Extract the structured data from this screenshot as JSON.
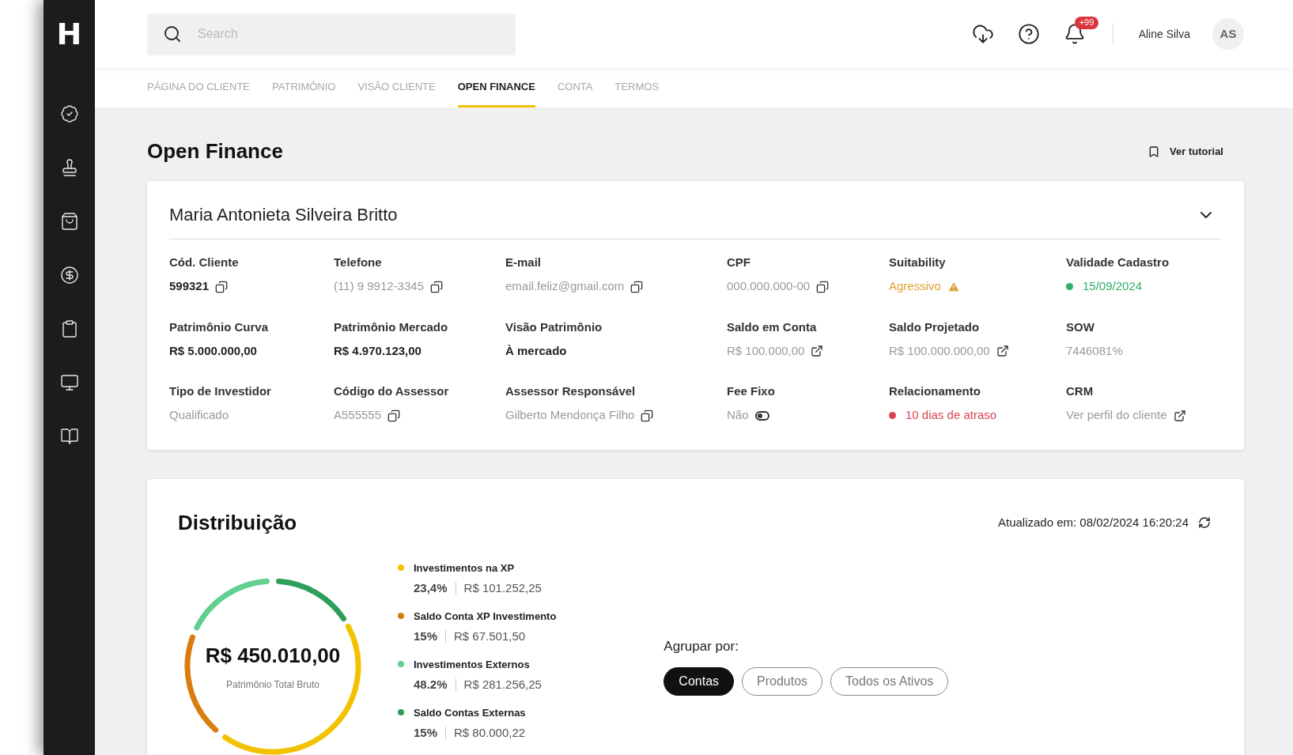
{
  "logo": "H",
  "search": {
    "placeholder": "Search"
  },
  "header": {
    "notifications_badge": "+99",
    "user_name": "Aline Silva",
    "avatar": "AS"
  },
  "tabs": [
    {
      "label": "PÁGINA DO CLIENTE",
      "selected": false
    },
    {
      "label": "PATRIMÔNIO",
      "selected": false
    },
    {
      "label": "VISÃO CLIENTE",
      "selected": false
    },
    {
      "label": "OPEN FINANCE",
      "selected": true
    },
    {
      "label": "CONTA",
      "selected": false
    },
    {
      "label": "TERMOS",
      "selected": false
    }
  ],
  "page_title": "Open Finance",
  "tutorial_link": "Ver tutorial",
  "client": {
    "name": "Maria Antonieta Silveira Britto",
    "fields": [
      {
        "label": "Cód. Cliente",
        "value": "599321",
        "kind": "copy",
        "strong": true
      },
      {
        "label": "Telefone",
        "value": "(11) 9 9912-3345",
        "kind": "copy",
        "strong": false
      },
      {
        "label": "E-mail",
        "value": "email.feliz@gmail.com",
        "kind": "copy",
        "strong": false
      },
      {
        "label": "CPF",
        "value": "000.000.000-00",
        "kind": "copy",
        "strong": false
      },
      {
        "label": "Suitability",
        "value": "Agressivo",
        "kind": "warning",
        "strong": false
      },
      {
        "label": "Validade Cadastro",
        "value": "15/09/2024",
        "kind": "status",
        "color": "#2fae66",
        "strong": false
      },
      {
        "label": "Patrimônio Curva",
        "value": "R$ 5.000.000,00",
        "kind": "plain",
        "strong": true
      },
      {
        "label": "Patrimônio Mercado",
        "value": "R$ 4.970.123,00",
        "kind": "plain",
        "strong": true
      },
      {
        "label": "Visão Patrimônio",
        "value": "À mercado",
        "kind": "plain",
        "strong": true
      },
      {
        "label": "Saldo em Conta",
        "value": "R$ 100.000,00",
        "kind": "link",
        "strong": false
      },
      {
        "label": "Saldo Projetado",
        "value": "R$ 100.000.000,00",
        "kind": "link",
        "strong": false
      },
      {
        "label": "SOW",
        "value": "7446081%",
        "kind": "plain",
        "strong": false
      },
      {
        "label": "Tipo de Investidor",
        "value": "Qualificado",
        "kind": "plain",
        "strong": false
      },
      {
        "label": "Código do Assessor",
        "value": "A555555",
        "kind": "copy",
        "strong": false
      },
      {
        "label": "Assessor Responsável",
        "value": "Gilberto Mendonça Filho",
        "kind": "copy",
        "strong": false
      },
      {
        "label": "Fee Fixo",
        "value": "Não",
        "kind": "toggle",
        "on": false,
        "strong": false
      },
      {
        "label": "Relacionamento",
        "value": "10 dias de atraso",
        "kind": "status",
        "color": "#d9434b",
        "strong": false
      },
      {
        "label": "CRM",
        "value": "Ver perfil do cliente",
        "kind": "link",
        "strong": false
      }
    ]
  },
  "distribution": {
    "title": "Distribuição",
    "updated": "Atualizado em: 08/02/2024 16:20:24",
    "total": "R$ 450.010,00",
    "total_label": "Patrimônio Total Bruto",
    "legend": [
      {
        "name": "Investimentos na XP",
        "percent": "23,4%",
        "amount": "R$ 101.252,25",
        "color": "#f2c200"
      },
      {
        "name": "Saldo Conta XP Investimento",
        "percent": "15%",
        "amount": "R$ 67.501,50",
        "color": "#d97d0e"
      },
      {
        "name": "Investimentos Externos",
        "percent": "48.2%",
        "amount": "R$ 281.256,25",
        "color": "#5fd08f"
      },
      {
        "name": "Saldo Contas Externas",
        "percent": "15%",
        "amount": "R$ 80.000,22",
        "color": "#2e9e5b"
      }
    ],
    "group_by": {
      "label": "Agrupar por:",
      "options": [
        {
          "label": "Contas",
          "selected": true
        },
        {
          "label": "Produtos",
          "selected": false
        },
        {
          "label": "Todos os Ativos",
          "selected": false
        }
      ]
    }
  }
}
